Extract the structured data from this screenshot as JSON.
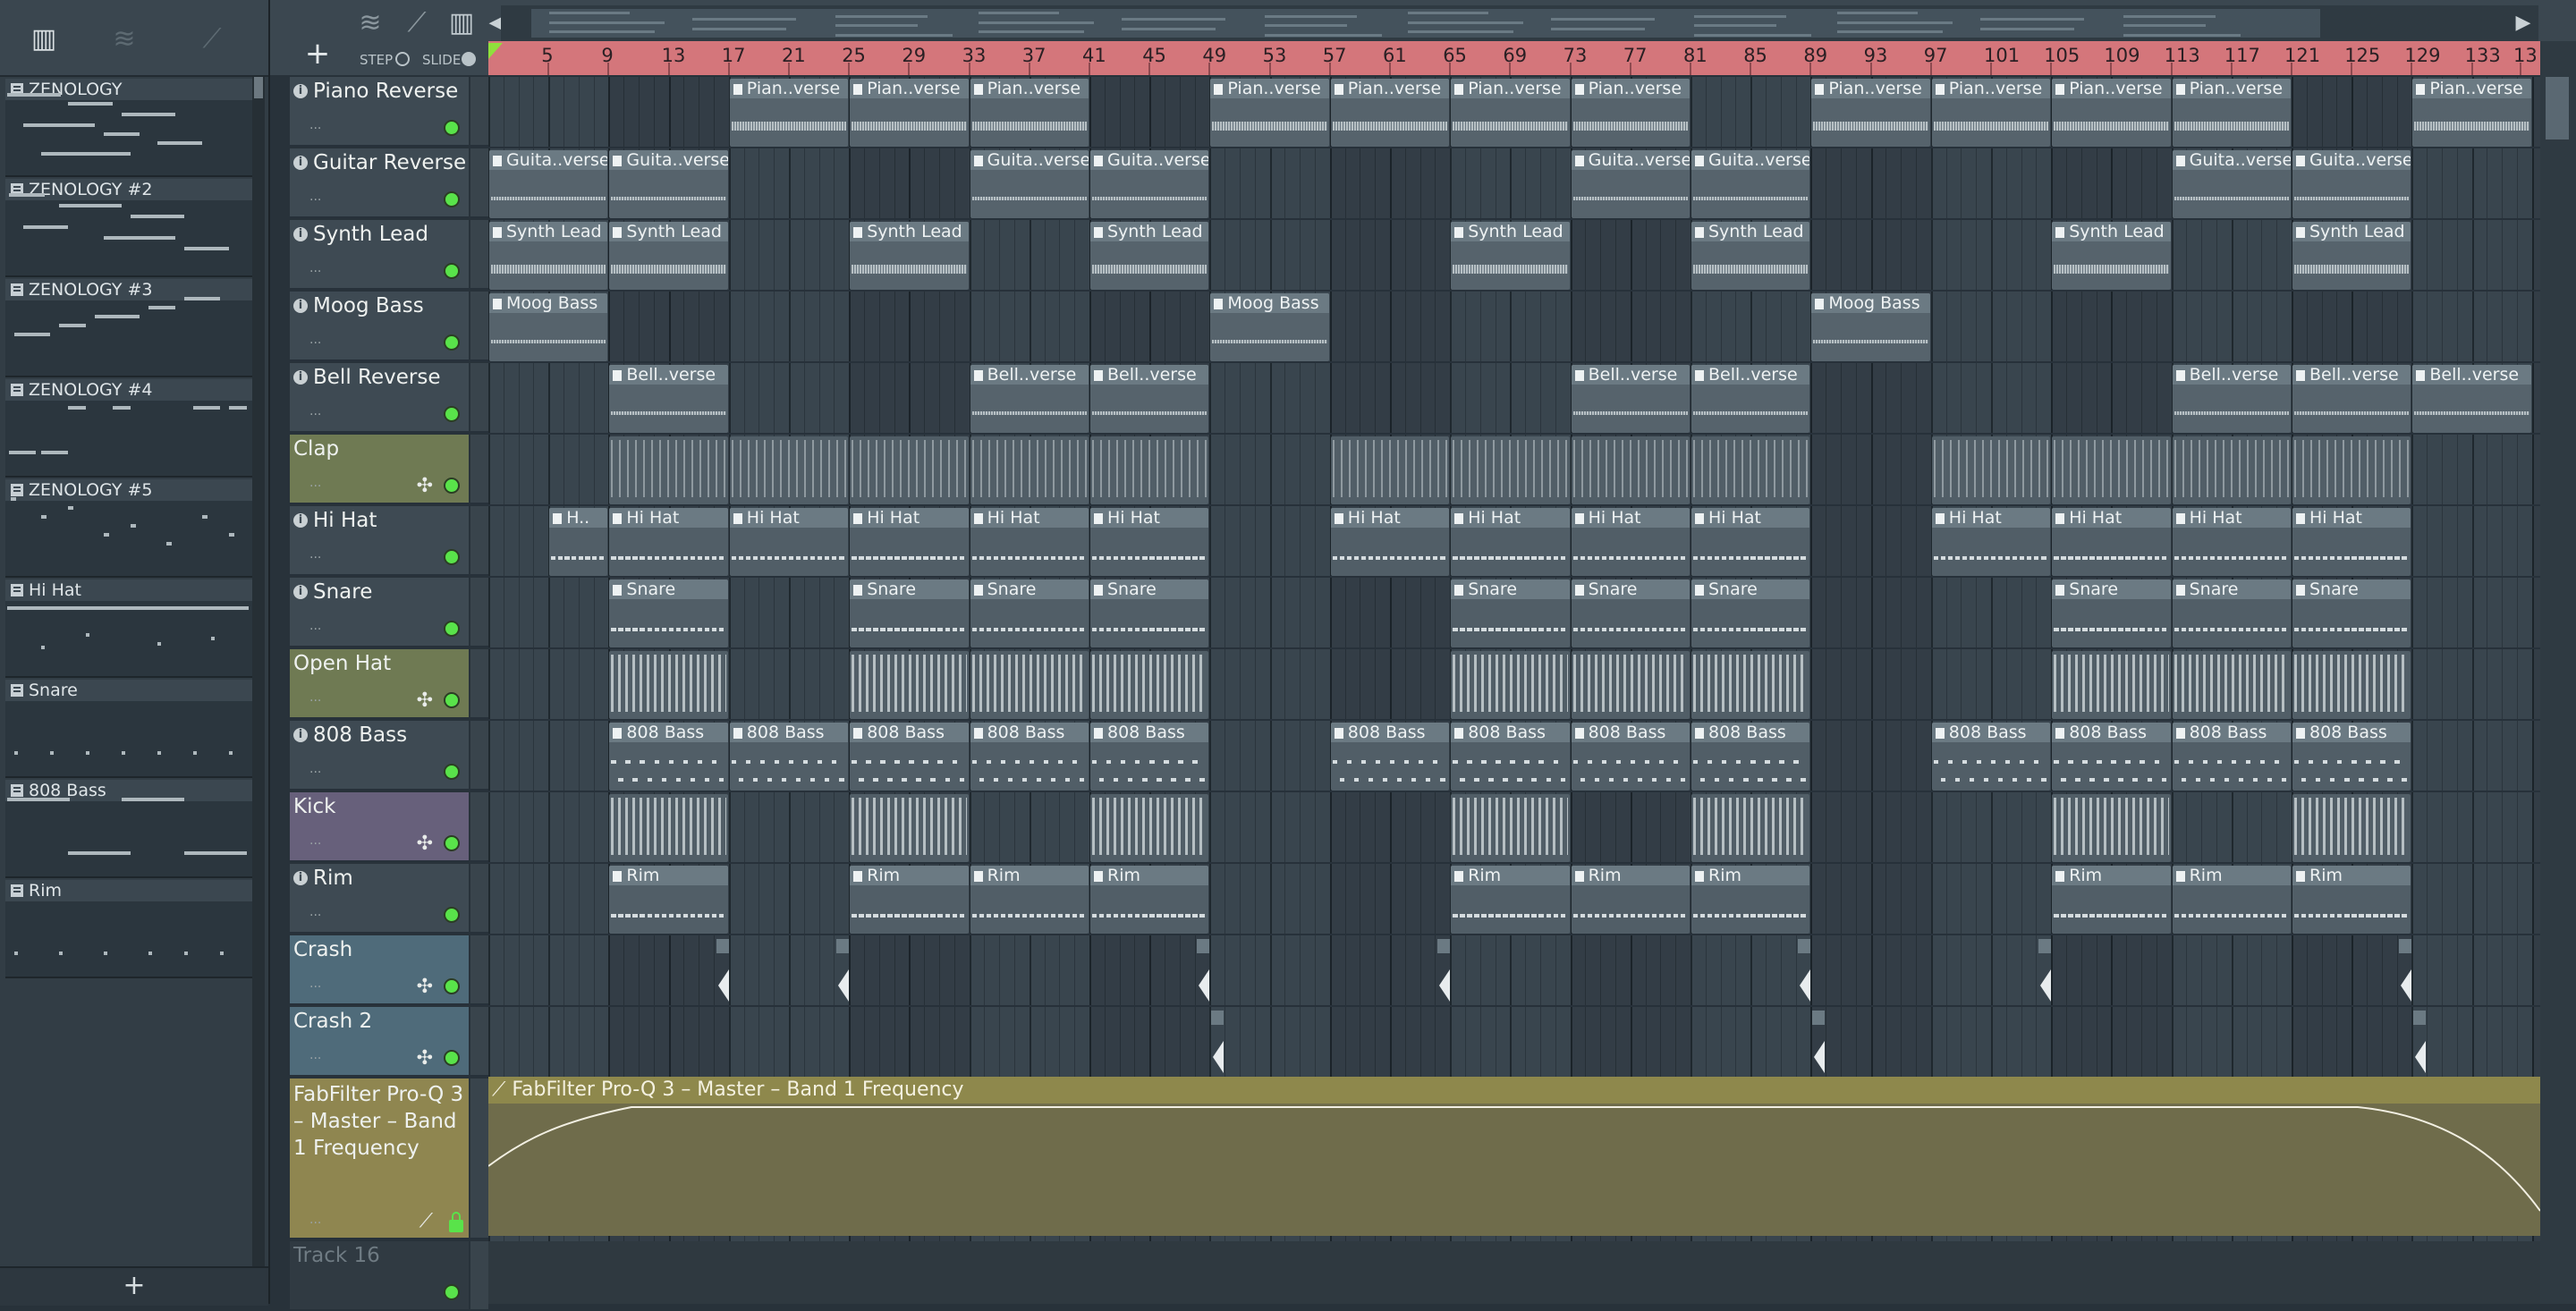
{
  "picker": {
    "tools": [
      "piano-roll",
      "waveform",
      "automation"
    ],
    "patterns": [
      {
        "label": "ZENOLOGY"
      },
      {
        "label": "ZENOLOGY #2"
      },
      {
        "label": "ZENOLOGY #3"
      },
      {
        "label": "ZENOLOGY #4"
      },
      {
        "label": "ZENOLOGY #5"
      },
      {
        "label": "Hi Hat"
      },
      {
        "label": "Snare"
      },
      {
        "label": "808 Bass"
      },
      {
        "label": "Rim"
      }
    ],
    "add_label": "+"
  },
  "header": {
    "add_track": "+",
    "step_label": "STEP",
    "slide_label": "SLIDE",
    "overview_left": "◀",
    "overview_right": "▶"
  },
  "ruler": {
    "bars": [
      "5",
      "9",
      "13",
      "17",
      "21",
      "25",
      "29",
      "33",
      "37",
      "41",
      "45",
      "49",
      "53",
      "57",
      "61",
      "65",
      "69",
      "73",
      "77",
      "81",
      "85",
      "89",
      "93",
      "97",
      "101",
      "105",
      "109",
      "113",
      "117",
      "121",
      "125",
      "129",
      "133",
      "13"
    ]
  },
  "tracks": [
    {
      "name": "Piano Reverse",
      "info": true,
      "sym": "",
      "tint": ""
    },
    {
      "name": "Guitar Reverse",
      "info": true,
      "sym": "",
      "tint": ""
    },
    {
      "name": "Synth Lead",
      "info": true,
      "sym": "",
      "tint": ""
    },
    {
      "name": "Moog Bass",
      "info": true,
      "sym": "",
      "tint": ""
    },
    {
      "name": "Bell Reverse",
      "info": true,
      "sym": "",
      "tint": ""
    },
    {
      "name": "Clap",
      "info": false,
      "sym": "✣",
      "tint": "green"
    },
    {
      "name": "Hi Hat",
      "info": true,
      "sym": "",
      "tint": ""
    },
    {
      "name": "Snare",
      "info": true,
      "sym": "",
      "tint": ""
    },
    {
      "name": "Open Hat",
      "info": false,
      "sym": "✣",
      "tint": "green"
    },
    {
      "name": "808 Bass",
      "info": true,
      "sym": "",
      "tint": ""
    },
    {
      "name": "Kick",
      "info": false,
      "sym": "✣",
      "tint": "purple"
    },
    {
      "name": "Rim",
      "info": true,
      "sym": "",
      "tint": ""
    },
    {
      "name": "Crash",
      "info": false,
      "sym": "✣",
      "tint": "blue"
    },
    {
      "name": "Crash 2",
      "info": false,
      "sym": "✣",
      "tint": "blue"
    }
  ],
  "automation_track": {
    "name": "FabFilter Pro-Q 3 – Master – Band 1 Frequency",
    "clip_title": "FabFilter Pro-Q 3 – Master – Band 1 Frequency"
  },
  "empty_track": {
    "name": "Track 16"
  },
  "clip_labels": {
    "piano": "Pian..verse",
    "guitar": "Guita..verse",
    "synth": "Synth Lead",
    "moog": "Moog Bass",
    "bell": "Bell..verse",
    "hihat": "Hi Hat",
    "hihat_short": "H..",
    "snare": "Snare",
    "bass808": "808 Bass",
    "rim": "Rim"
  },
  "colors": {
    "ruler": "#d4767b",
    "led": "#59e34a",
    "automation": "#8e884c"
  }
}
